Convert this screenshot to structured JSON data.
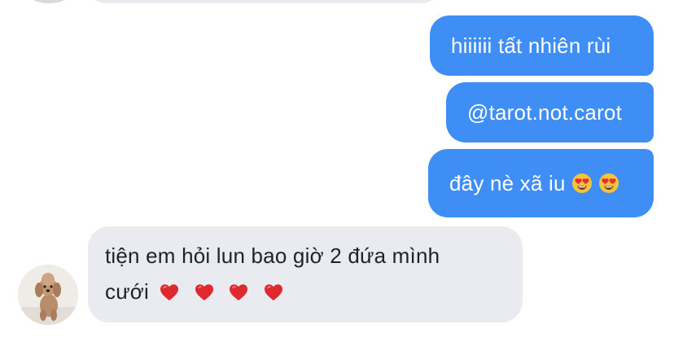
{
  "messages": [
    {
      "direction": "outgoing",
      "text": "hiiiiii tất nhiên rùi"
    },
    {
      "direction": "outgoing",
      "text": "@tarot.not.carot"
    },
    {
      "direction": "outgoing",
      "text": "đây nè xã iu",
      "emoji": [
        "heart-eyes-emoji",
        "heart-eyes-emoji"
      ]
    },
    {
      "direction": "incoming",
      "line1": "tiện em hỏi lun bao giờ 2 đứa mình",
      "line2": "cưới",
      "emoji": [
        "red-heart-emoji",
        "red-heart-emoji",
        "red-heart-emoji",
        "red-heart-emoji"
      ]
    }
  ],
  "colors": {
    "outgoing_bubble": "#3f8ef6",
    "incoming_bubble": "#e9ebf0",
    "background": "#ffffff"
  },
  "avatar": {
    "icon": "poodle-avatar-icon"
  }
}
